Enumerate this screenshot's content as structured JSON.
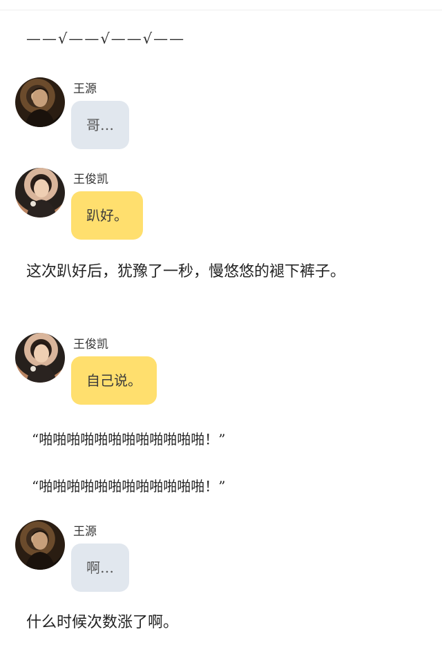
{
  "divider": "——√——√——√——",
  "messages": [
    {
      "name": "王源",
      "text": "哥…"
    },
    {
      "name": "王俊凯",
      "text": "趴好。"
    },
    {
      "name": "王俊凯",
      "text": "自己说。"
    },
    {
      "name": "王源",
      "text": "啊…"
    }
  ],
  "narration": [
    "这次趴好后，犹豫了一秒，慢悠悠的褪下裤子。",
    "什么时候次数涨了啊。"
  ],
  "quotes": [
    "“啪啪啪啪啪啪啪啪啪啪啪啪！”",
    "“啪啪啪啪啪啪啪啪啪啪啪啪！”"
  ],
  "colors": {
    "bubble_grey": "#e1e7ee",
    "bubble_yellow": "#ffdf6e"
  }
}
